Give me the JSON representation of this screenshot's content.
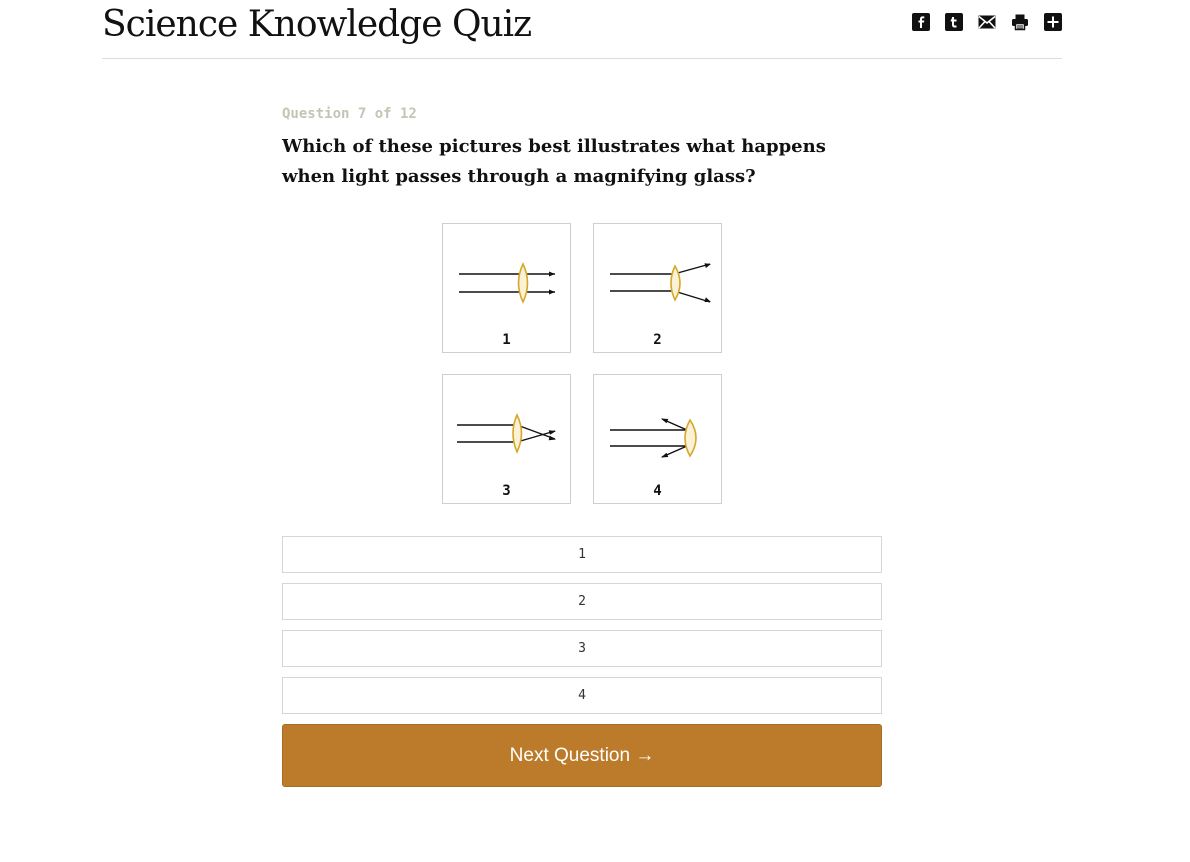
{
  "header": {
    "title": "Science Knowledge Quiz",
    "share_icons": [
      "facebook-icon",
      "tumblr-icon",
      "email-icon",
      "print-icon",
      "more-icon"
    ]
  },
  "quiz": {
    "progress": "Question 7 of 12",
    "question": "Which of these pictures best illustrates what happens when light passes through a magnifying glass?",
    "figures": [
      {
        "label": "1",
        "depiction": "rays pass straight through lens"
      },
      {
        "label": "2",
        "depiction": "rays spread apart after lens"
      },
      {
        "label": "3",
        "depiction": "rays converge and cross after lens"
      },
      {
        "label": "4",
        "depiction": "rays reflect back off lens"
      }
    ],
    "answers": [
      "1",
      "2",
      "3",
      "4"
    ],
    "next_label": "Next Question →"
  },
  "colors": {
    "button": "#bc7b2a",
    "lens_stroke": "#d4a82a",
    "lens_fill": "#fbf1d6",
    "progress_text": "#c4c4b4"
  }
}
